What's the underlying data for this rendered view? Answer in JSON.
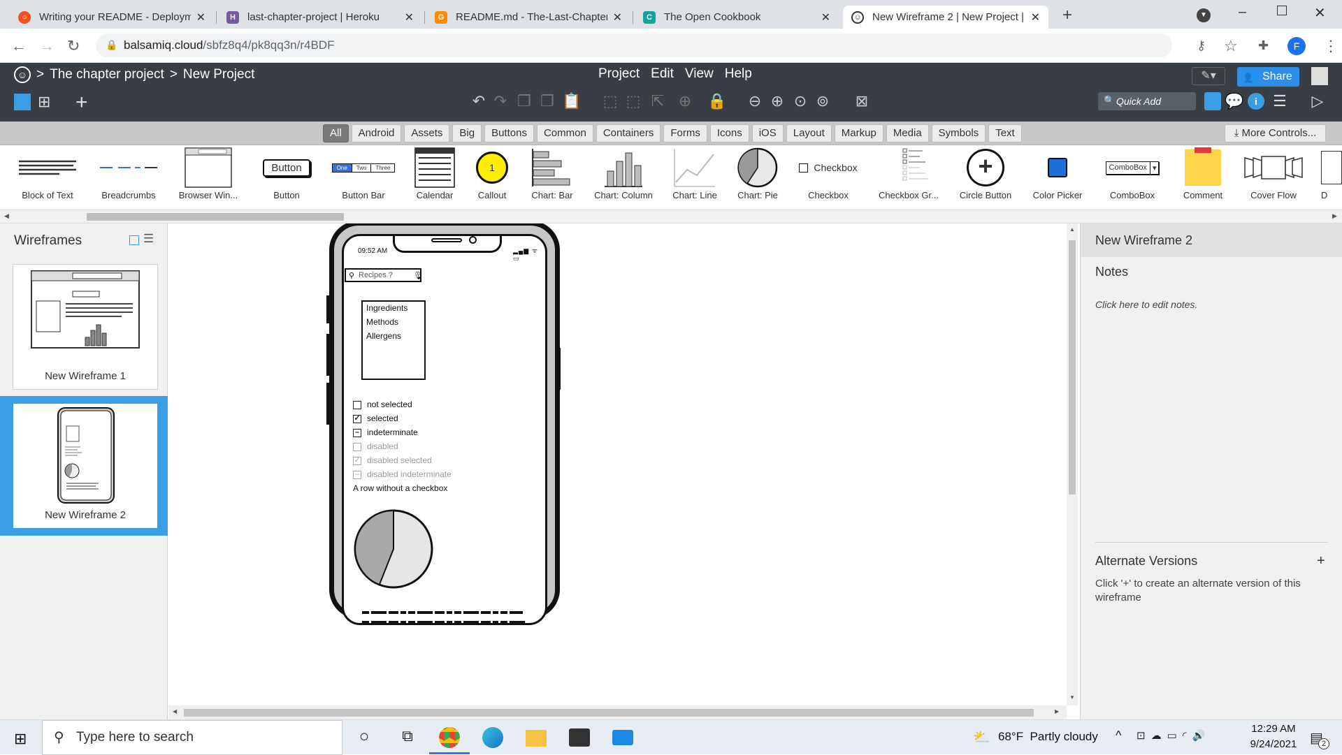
{
  "browser": {
    "tabs": [
      {
        "title": "Writing your README - Deploym",
        "icon": "circle-logo-icon",
        "color": "#f4511e"
      },
      {
        "title": "last-chapter-project | Heroku",
        "icon": "heroku-icon",
        "color": "#79589f"
      },
      {
        "title": "README.md - The-Last-Chapter",
        "icon": "gitpod-icon",
        "color": "#ff8a00"
      },
      {
        "title": "The Open Cookbook",
        "icon": "c-logo-icon",
        "color": "#12a39a"
      },
      {
        "title": "New Wireframe 2 | New Project |",
        "icon": "balsamiq-face-icon",
        "color": "#333333"
      }
    ],
    "url_host": "balsamiq.cloud",
    "url_path": "/sbfz8q4/pk8qq3n/r4BDF",
    "profile_initial": "F"
  },
  "app": {
    "breadcrumb": [
      ">",
      "The chapter project",
      ">",
      "New Project"
    ],
    "menu": [
      "Project",
      "Edit",
      "View",
      "Help"
    ],
    "share_label": "Share",
    "quick_add_placeholder": "Quick Add"
  },
  "categories": {
    "items": [
      "All",
      "Android",
      "Assets",
      "Big",
      "Buttons",
      "Common",
      "Containers",
      "Forms",
      "Icons",
      "iOS",
      "Layout",
      "Markup",
      "Media",
      "Symbols",
      "Text"
    ],
    "selected": "All",
    "more_controls": "More Controls..."
  },
  "library": [
    "Block of Text",
    "Breadcrumbs",
    "Browser Win...",
    "Button",
    "Button Bar",
    "Calendar",
    "Callout",
    "Chart: Bar",
    "Chart: Column",
    "Chart: Line",
    "Chart: Pie",
    "Checkbox",
    "Checkbox Gr...",
    "Circle Button",
    "Color Picker",
    "ComboBox",
    "Comment",
    "Cover Flow",
    "D"
  ],
  "library_previews": {
    "button": "Button",
    "button_bar": [
      "One",
      "Two",
      "Three"
    ],
    "callout": "1",
    "checkbox": "Checkbox",
    "combobox": "ComboBox"
  },
  "left_panel": {
    "header": "Wireframes",
    "wireframes": [
      {
        "name": "New Wireframe 1",
        "selected": false
      },
      {
        "name": "New Wireframe 2",
        "selected": true
      }
    ]
  },
  "right_panel": {
    "title": "New Wireframe 2",
    "notes_label": "Notes",
    "notes_placeholder": "Click here to edit notes.",
    "alt_versions_label": "Alternate Versions",
    "alt_versions_add": "+",
    "alt_versions_help": "Click '+' to create an alternate version of this wireframe"
  },
  "wireframe": {
    "time": "09:52 AM",
    "search_placeholder": "Recipes ?",
    "list_items": [
      "Ingredients",
      "Methods",
      "Allergens"
    ],
    "checkboxes": [
      {
        "label": "not selected",
        "state": "unchecked",
        "disabled": false
      },
      {
        "label": "selected",
        "state": "checked",
        "disabled": false
      },
      {
        "label": "indeterminate",
        "state": "indeterminate",
        "disabled": false
      },
      {
        "label": "disabled",
        "state": "unchecked",
        "disabled": true
      },
      {
        "label": "disabled selected",
        "state": "checked",
        "disabled": true
      },
      {
        "label": "disabled indeterminate",
        "state": "indeterminate",
        "disabled": true
      }
    ],
    "no_checkbox_row": "A row without a checkbox",
    "pie_fraction_dark": 0.44
  },
  "taskbar": {
    "search_placeholder": "Type here to search",
    "weather": "68°F  Partly cloudy",
    "time": "12:29 AM",
    "date": "9/24/2021",
    "notification_count": "2"
  }
}
